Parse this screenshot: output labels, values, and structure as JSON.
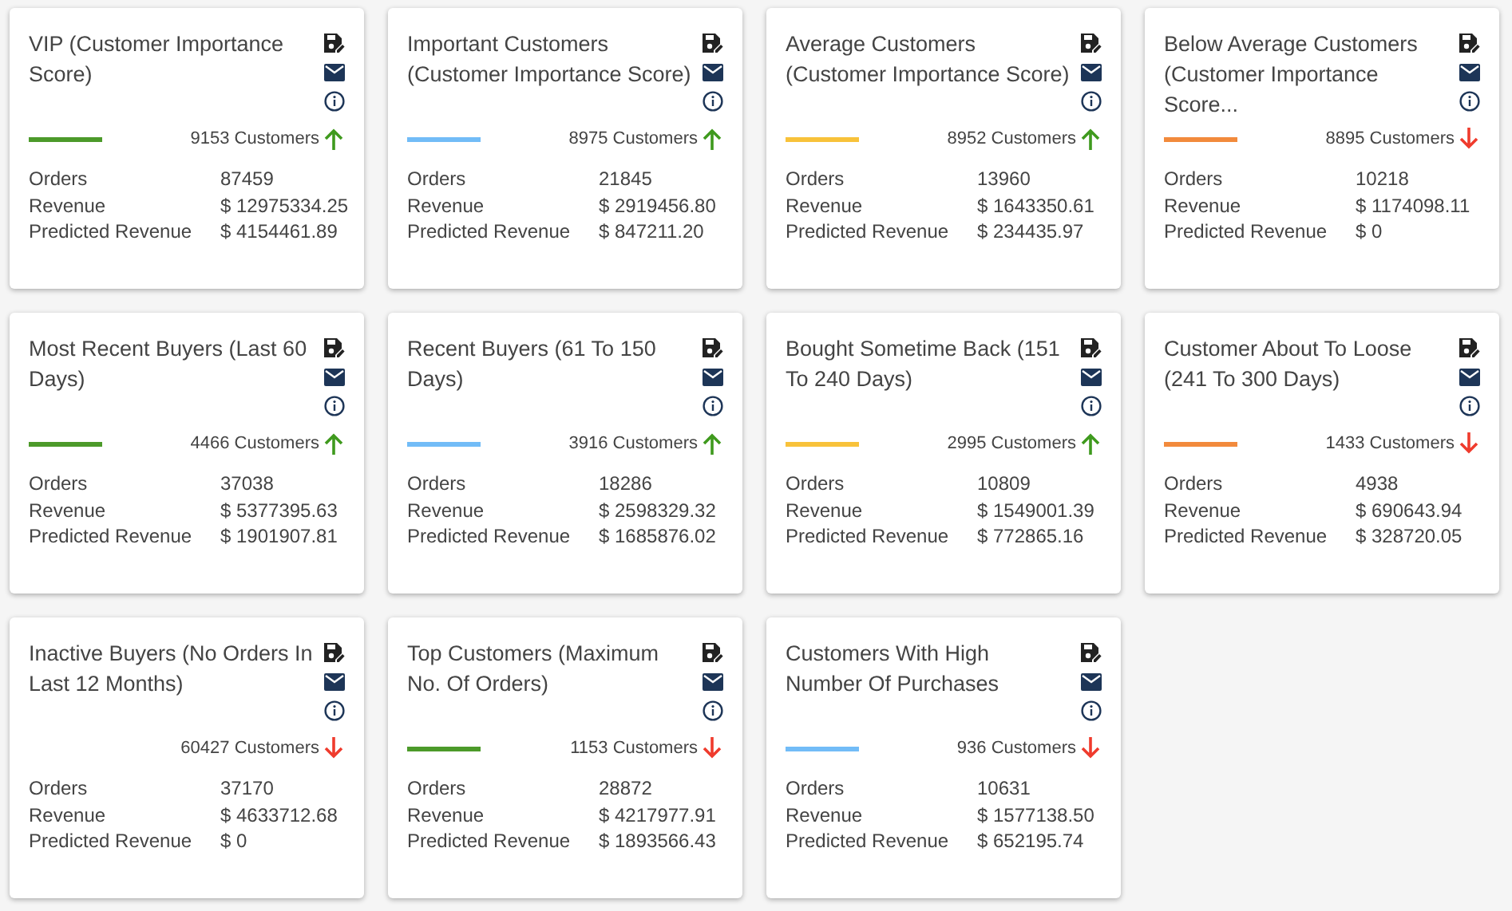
{
  "segments": [
    {
      "title": "VIP (Customer Importance Score)",
      "color": "#4c9a2a",
      "customers": "9153 Customers",
      "rising": true,
      "stats": [
        {
          "label": "Orders",
          "value": "87459"
        },
        {
          "label": "Revenue",
          "value": "$ 12975334.25"
        },
        {
          "label": "Predicted Revenue",
          "value": "$ 4154461.89"
        }
      ]
    },
    {
      "title": "Important Customers (Customer Importance Score)",
      "color": "#72bcf7",
      "customers": "8975 Customers",
      "rising": true,
      "stats": [
        {
          "label": "Orders",
          "value": "21845"
        },
        {
          "label": "Revenue",
          "value": "$ 2919456.80"
        },
        {
          "label": "Predicted Revenue",
          "value": "$ 847211.20"
        }
      ]
    },
    {
      "title": "Average Customers (Customer Importance Score)",
      "color": "#f8c23a",
      "customers": "8952 Customers",
      "rising": true,
      "stats": [
        {
          "label": "Orders",
          "value": "13960"
        },
        {
          "label": "Revenue",
          "value": "$ 1643350.61"
        },
        {
          "label": "Predicted Revenue",
          "value": "$ 234435.97"
        }
      ]
    },
    {
      "title": "Below Average Customers (Customer Importance Score...",
      "color": "#f28a3c",
      "customers": "8895 Customers",
      "rising": false,
      "stats": [
        {
          "label": "Orders",
          "value": "10218"
        },
        {
          "label": "Revenue",
          "value": "$ 1174098.11"
        },
        {
          "label": "Predicted Revenue",
          "value": "$ 0"
        }
      ]
    },
    {
      "title": "Most Recent Buyers (Last 60 Days)",
      "color": "#4c9a2a",
      "customers": "4466 Customers",
      "rising": true,
      "stats": [
        {
          "label": "Orders",
          "value": "37038"
        },
        {
          "label": "Revenue",
          "value": "$ 5377395.63"
        },
        {
          "label": "Predicted Revenue",
          "value": "$ 1901907.81"
        }
      ]
    },
    {
      "title": "Recent Buyers (61 To 150 Days)",
      "color": "#72bcf7",
      "customers": "3916 Customers",
      "rising": true,
      "stats": [
        {
          "label": "Orders",
          "value": "18286"
        },
        {
          "label": "Revenue",
          "value": "$ 2598329.32"
        },
        {
          "label": "Predicted Revenue",
          "value": "$ 1685876.02"
        }
      ]
    },
    {
      "title": "Bought Sometime Back (151 To 240 Days)",
      "color": "#f8c23a",
      "customers": "2995 Customers",
      "rising": true,
      "stats": [
        {
          "label": "Orders",
          "value": "10809"
        },
        {
          "label": "Revenue",
          "value": "$ 1549001.39"
        },
        {
          "label": "Predicted Revenue",
          "value": "$ 772865.16"
        }
      ]
    },
    {
      "title": "Customer About To Loose (241 To 300 Days)",
      "color": "#f28a3c",
      "customers": "1433 Customers",
      "rising": false,
      "stats": [
        {
          "label": "Orders",
          "value": "4938"
        },
        {
          "label": "Revenue",
          "value": "$ 690643.94"
        },
        {
          "label": "Predicted Revenue",
          "value": "$ 328720.05"
        }
      ]
    },
    {
      "title": "Inactive Buyers (No Orders In Last 12 Months)",
      "customers": "60427 Customers",
      "rising": false,
      "stats": [
        {
          "label": "Orders",
          "value": "37170"
        },
        {
          "label": "Revenue",
          "value": "$ 4633712.68"
        },
        {
          "label": "Predicted Revenue",
          "value": "$ 0"
        }
      ]
    },
    {
      "title": "Top Customers (Maximum No. Of Orders)",
      "color": "#4c9a2a",
      "customers": "1153 Customers",
      "rising": false,
      "stats": [
        {
          "label": "Orders",
          "value": "28872"
        },
        {
          "label": "Revenue",
          "value": "$ 4217977.91"
        },
        {
          "label": "Predicted Revenue",
          "value": "$ 1893566.43"
        }
      ]
    },
    {
      "title": "Customers With High Number Of Purchases",
      "color": "#72bcf7",
      "customers": "936 Customers",
      "rising": false,
      "stats": [
        {
          "label": "Orders",
          "value": "10631"
        },
        {
          "label": "Revenue",
          "value": "$ 1577138.50"
        },
        {
          "label": "Predicted Revenue",
          "value": "$ 652195.74"
        }
      ]
    }
  ]
}
